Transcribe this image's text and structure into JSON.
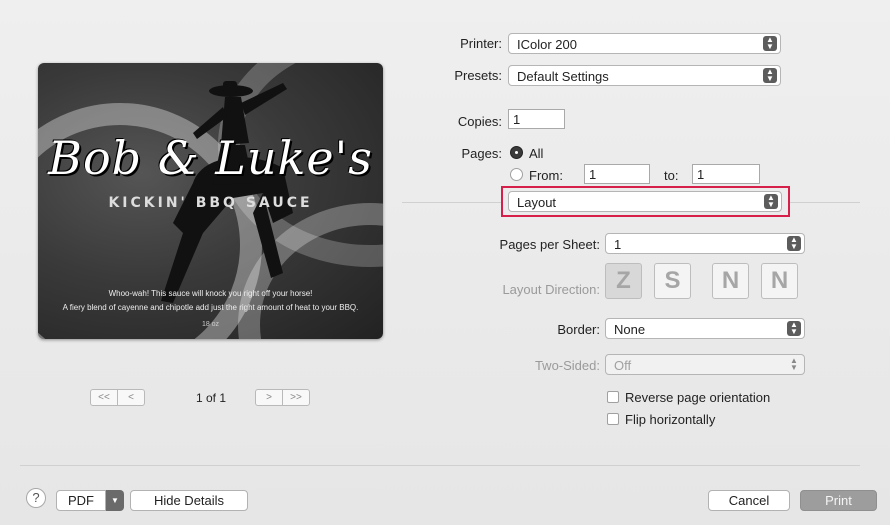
{
  "preview": {
    "title": "Bob & Luke's",
    "subtitle": "KICKIN' BBQ SAUCE",
    "tagline1": "Whoo-wah! This sauce will knock you right off your horse!",
    "tagline2": "A fiery blend of cayenne and chipotle add just the right amount of heat to your BBQ.",
    "size": "18 oz"
  },
  "nav": {
    "first": "<<",
    "prev": "<",
    "next": ">",
    "last": ">>",
    "page_count": "1 of 1"
  },
  "printer": {
    "label": "Printer:",
    "value": "IColor 200"
  },
  "presets": {
    "label": "Presets:",
    "value": "Default Settings"
  },
  "copies": {
    "label": "Copies:",
    "value": "1"
  },
  "pages": {
    "label": "Pages:",
    "all_label": "All",
    "from_label": "From:",
    "from_value": "1",
    "to_label": "to:",
    "to_value": "1",
    "selected": "All"
  },
  "section": {
    "value": "Layout"
  },
  "pages_per_sheet": {
    "label": "Pages per Sheet:",
    "value": "1"
  },
  "layout_direction": {
    "label": "Layout Direction:",
    "icons": [
      "Z",
      "S",
      "N",
      "N"
    ]
  },
  "border": {
    "label": "Border:",
    "value": "None"
  },
  "two_sided": {
    "label": "Two-Sided:",
    "value": "Off"
  },
  "options": {
    "reverse_label": "Reverse page orientation",
    "flip_label": "Flip horizontally"
  },
  "footer": {
    "help": "?",
    "pdf": "PDF",
    "hide_details": "Hide Details",
    "cancel": "Cancel",
    "print": "Print"
  },
  "colors": {
    "highlight": "#d6204a",
    "arrow_bg": "#5c5c5c"
  }
}
